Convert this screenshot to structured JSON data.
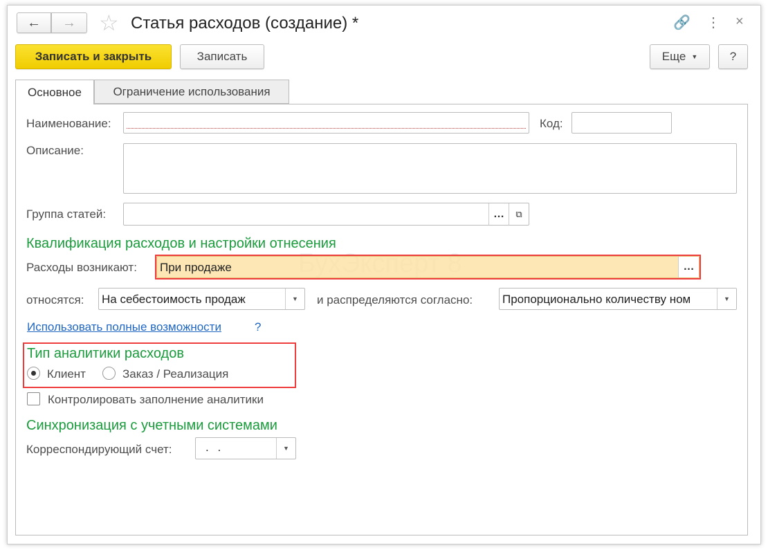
{
  "title": "Статья расходов (создание) *",
  "toolbar": {
    "save_close": "Записать и закрыть",
    "save": "Записать",
    "more": "Еще",
    "help": "?"
  },
  "tabs": [
    {
      "label": "Основное"
    },
    {
      "label": "Ограничение использования"
    }
  ],
  "form": {
    "name_label": "Наименование:",
    "name_value": "",
    "code_label": "Код:",
    "code_value": "",
    "description_label": "Описание:",
    "description_value": "",
    "group_label": "Группа статей:",
    "group_value": "",
    "section1": "Квалификация расходов и настройки отнесения",
    "arise_label": "Расходы возникают:",
    "arise_value": "При продаже",
    "relate_label": "относятся:",
    "relate_value": "На себестоимость продаж",
    "distribute_label": "и распределяются согласно:",
    "distribute_value": "Пропорционально количеству ном",
    "full_link": "Использовать полные возможности",
    "full_help": "?",
    "section2": "Тип аналитики расходов",
    "radio": [
      {
        "label": "Клиент",
        "checked": true
      },
      {
        "label": "Заказ / Реализация",
        "checked": false
      }
    ],
    "control_label": "Контролировать заполнение аналитики",
    "control_checked": false,
    "section3": "Синхронизация с учетными системами",
    "account_label": "Корреспондирующий счет:",
    "account_value": ". ."
  },
  "watermark": "БухЭксперт 8",
  "colors": {
    "accent": "#f5d400",
    "section": "#1a9b3c",
    "highlight": "#fbe7b4",
    "red": "#ee3b3b",
    "link": "#1f66c1"
  }
}
